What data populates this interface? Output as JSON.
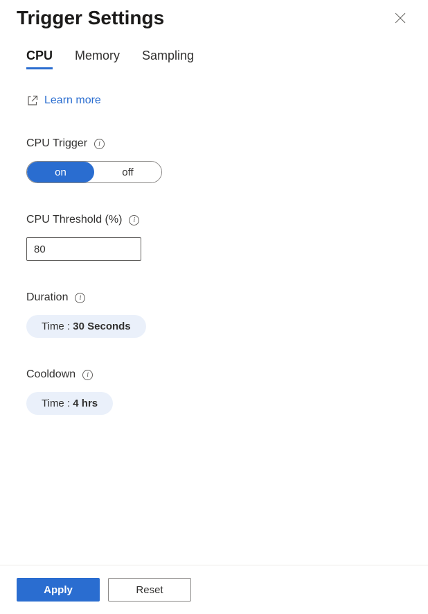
{
  "header": {
    "title": "Trigger Settings"
  },
  "tabs": [
    {
      "label": "CPU",
      "active": true
    },
    {
      "label": "Memory",
      "active": false
    },
    {
      "label": "Sampling",
      "active": false
    }
  ],
  "learnMore": {
    "label": "Learn more"
  },
  "fields": {
    "cpuTrigger": {
      "label": "CPU Trigger",
      "onLabel": "on",
      "offLabel": "off",
      "value": "on"
    },
    "cpuThreshold": {
      "label": "CPU Threshold (%)",
      "value": "80"
    },
    "duration": {
      "label": "Duration",
      "prefix": "Time : ",
      "value": "30 Seconds"
    },
    "cooldown": {
      "label": "Cooldown",
      "prefix": "Time : ",
      "value": "4 hrs"
    }
  },
  "footer": {
    "apply": "Apply",
    "reset": "Reset"
  }
}
